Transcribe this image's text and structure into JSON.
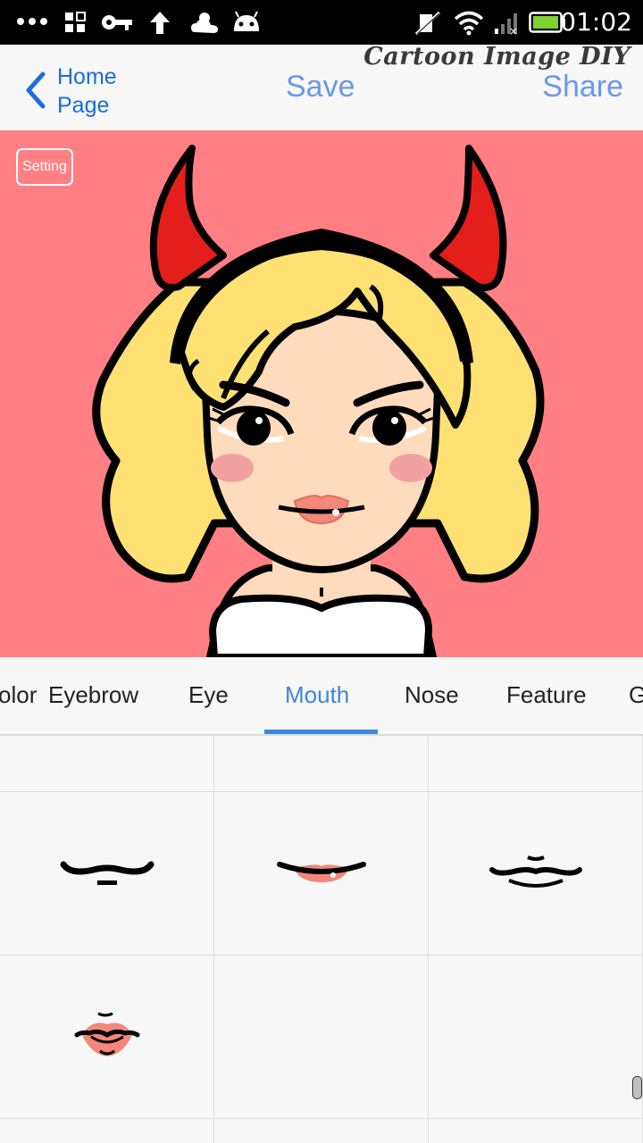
{
  "status_bar": {
    "time": "01:02",
    "icons": [
      "more-dots-icon",
      "grid-app-icon",
      "key-icon",
      "upload-arrow-icon",
      "weather-icon",
      "android-icon",
      "silent-icon",
      "wifi-icon",
      "signal-icon",
      "battery-icon"
    ],
    "battery_color": "#7fd32e"
  },
  "header": {
    "back_label": "Home Page",
    "save_label": "Save",
    "share_label": "Share",
    "brand": "Cartoon Image DIY",
    "accent": "#3d86d8"
  },
  "canvas": {
    "setting_label": "Setting",
    "background": "#ff7f84"
  },
  "tabs": {
    "items": [
      "olor",
      "Eyebrow",
      "Eye",
      "Mouth",
      "Nose",
      "Feature",
      "G"
    ],
    "active": "Mouth"
  },
  "mouth_options": [
    "mouth-style-empty-top",
    "mouth-style-smirk",
    "mouth-style-pink-lips",
    "mouth-style-mustache-smile",
    "mouth-style-pouty-lips"
  ]
}
